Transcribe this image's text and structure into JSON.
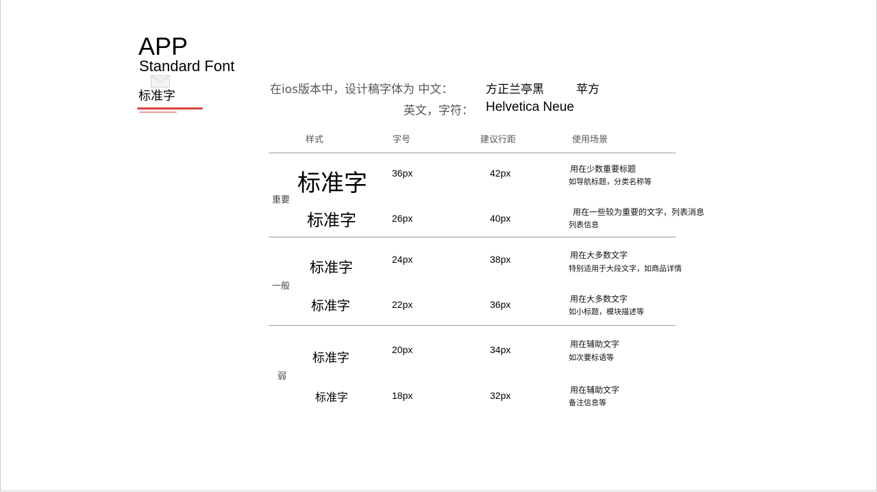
{
  "header": {
    "app": "APP",
    "subtitle": "Standard Font",
    "cn_title": "标准字"
  },
  "intro": {
    "line1_label": "在ios版本中，设计稿字体为 中文：",
    "line1_font1": "方正兰亭黑",
    "line1_font2": "苹方",
    "line2_label": "英文，字符：",
    "line2_font": "Helvetica Neue"
  },
  "columns": [
    "样式",
    "字号",
    "建议行距",
    "使用场景"
  ],
  "groups": [
    "重要",
    "一般",
    "弱"
  ],
  "rows": [
    {
      "sample": "标准字",
      "size": "36px",
      "leading": "42px",
      "usage": "用在少数重要标题",
      "example": "如导航标题，分类名称等"
    },
    {
      "sample": "标准字",
      "size": "26px",
      "leading": "40px",
      "usage": "用在一些较为重要的文字，列表消息",
      "example": "列表信息"
    },
    {
      "sample": "标准字",
      "size": "24px",
      "leading": "38px",
      "usage": "用在大多数文字",
      "example": "特别适用于大段文字，如商品详情"
    },
    {
      "sample": "标准字",
      "size": "22px",
      "leading": "36px",
      "usage": "用在大多数文字",
      "example": "如小标题，模块描述等"
    },
    {
      "sample": "标准字",
      "size": "20px",
      "leading": "34px",
      "usage": "用在辅助文字",
      "example": "如次要标语等"
    },
    {
      "sample": "标准字",
      "size": "18px",
      "leading": "32px",
      "usage": "用在辅助文字",
      "example": "备注信息等"
    }
  ],
  "colors": {
    "accent_underline": "#d9413a"
  },
  "icons": {
    "envelope": "envelope-icon"
  }
}
